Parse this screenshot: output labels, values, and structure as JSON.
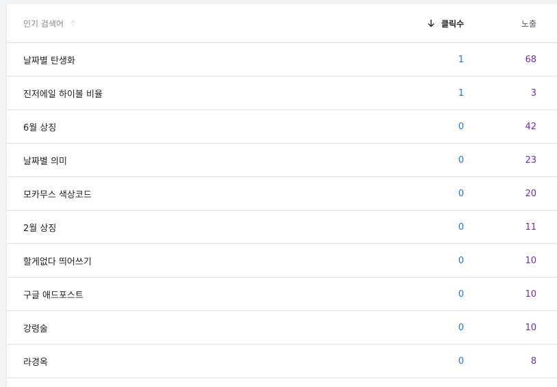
{
  "table": {
    "headers": {
      "query": "인기 검색어",
      "clicks": "클릭수",
      "impressions": "노출"
    },
    "rows": [
      {
        "query": "날짜별 탄생화",
        "clicks": "1",
        "impressions": "68"
      },
      {
        "query": "진저에일 하이볼 비율",
        "clicks": "1",
        "impressions": "3"
      },
      {
        "query": "6월 상징",
        "clicks": "0",
        "impressions": "42"
      },
      {
        "query": "날짜별 의미",
        "clicks": "0",
        "impressions": "23"
      },
      {
        "query": "모카무스 색상코드",
        "clicks": "0",
        "impressions": "20"
      },
      {
        "query": "2월 상징",
        "clicks": "0",
        "impressions": "11"
      },
      {
        "query": "할게없다 띄어쓰기",
        "clicks": "0",
        "impressions": "10"
      },
      {
        "query": "구글 애드포스트",
        "clicks": "0",
        "impressions": "10"
      },
      {
        "query": "강령술",
        "clicks": "0",
        "impressions": "10"
      },
      {
        "query": "라경옥",
        "clicks": "0",
        "impressions": "8"
      }
    ]
  },
  "colors": {
    "clicks": "#1a73e8",
    "impressions": "#7627bb"
  },
  "icons": {
    "query_sort": "arrow-up-icon",
    "clicks_sort": "arrow-down-icon"
  }
}
